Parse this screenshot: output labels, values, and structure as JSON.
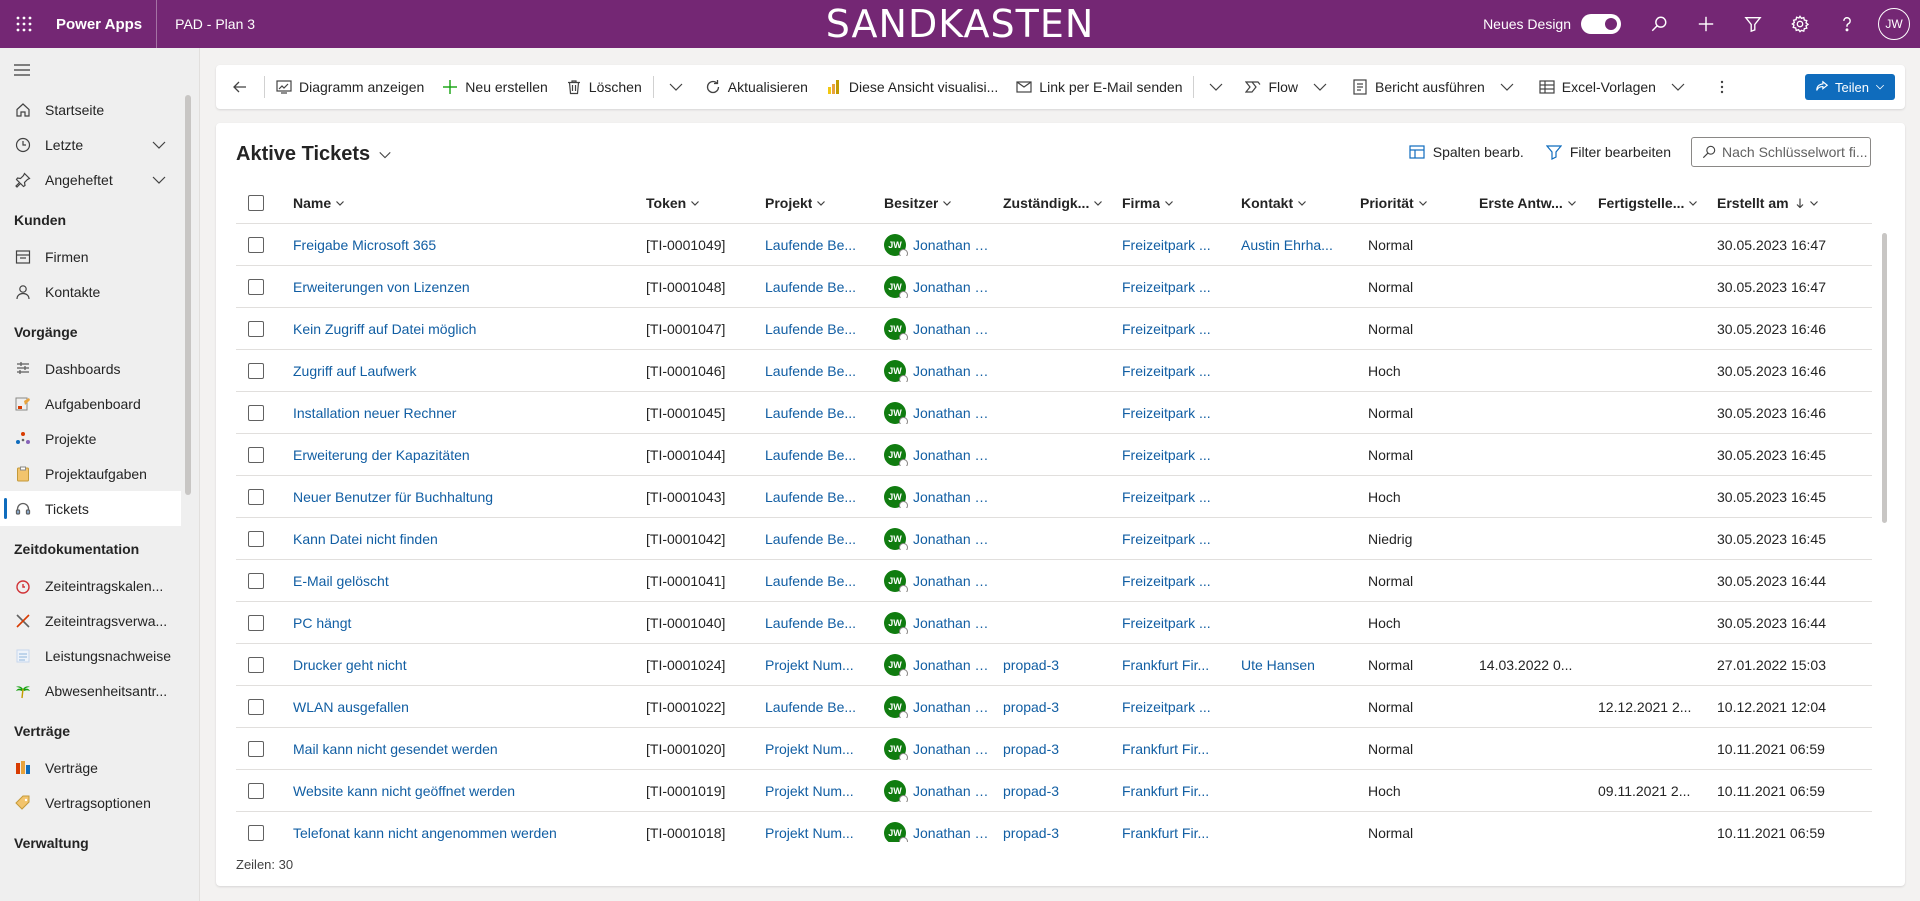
{
  "header": {
    "app_name": "Power Apps",
    "env_name": "PAD - Plan 3",
    "banner": "SANDKASTEN",
    "new_design_label": "Neues Design",
    "user_initials": "JW"
  },
  "sidebar": {
    "items_top": [
      {
        "label": "Startseite",
        "icon": "home-icon"
      },
      {
        "label": "Letzte",
        "icon": "clock-icon"
      },
      {
        "label": "Angeheftet",
        "icon": "pin-icon"
      }
    ],
    "groups": [
      {
        "title": "Kunden",
        "items": [
          {
            "label": "Firmen",
            "icon": "building-icon"
          },
          {
            "label": "Kontakte",
            "icon": "person-icon"
          }
        ]
      },
      {
        "title": "Vorgänge",
        "items": [
          {
            "label": "Dashboards",
            "icon": "dashboard-icon"
          },
          {
            "label": "Aufgabenboard",
            "icon": "board-icon"
          },
          {
            "label": "Projekte",
            "icon": "projects-icon"
          },
          {
            "label": "Projektaufgaben",
            "icon": "clipboard-icon"
          },
          {
            "label": "Tickets",
            "icon": "headset-icon"
          }
        ]
      },
      {
        "title": "Zeitdokumentation",
        "items": [
          {
            "label": "Zeiteintragskalen...",
            "icon": "stopwatch-icon"
          },
          {
            "label": "Zeiteintragsverwa...",
            "icon": "tools-icon"
          },
          {
            "label": "Leistungsnachweise",
            "icon": "list-icon"
          },
          {
            "label": "Abwesenheitsantr...",
            "icon": "palm-icon"
          }
        ]
      },
      {
        "title": "Verträge",
        "items": [
          {
            "label": "Verträge",
            "icon": "contract-icon"
          },
          {
            "label": "Vertragsoptionen",
            "icon": "tag-icon"
          }
        ]
      },
      {
        "title": "Verwaltung",
        "items": []
      }
    ]
  },
  "toolbar": {
    "chart": "Diagramm anzeigen",
    "new": "Neu erstellen",
    "delete": "Löschen",
    "refresh": "Aktualisieren",
    "visualize": "Diese Ansicht visualisi...",
    "email_link": "Link per E-Mail senden",
    "flow": "Flow",
    "report": "Bericht ausführen",
    "excel": "Excel-Vorlagen",
    "share": "Teilen"
  },
  "view": {
    "title": "Aktive Tickets",
    "edit_columns": "Spalten bearb.",
    "edit_filters": "Filter bearbeiten",
    "search_placeholder": "Nach Schlüsselwort fi...",
    "row_count": "Zeilen: 30"
  },
  "columns": {
    "name": "Name",
    "token": "Token",
    "projekt": "Projekt",
    "besitzer": "Besitzer",
    "zustaendig": "Zuständigk...",
    "firma": "Firma",
    "kontakt": "Kontakt",
    "prioritaet": "Priorität",
    "erste_antwort": "Erste Antw...",
    "fertigstellen": "Fertigstelle...",
    "erstellt_am": "Erstellt am"
  },
  "rows": [
    {
      "name": "Freigabe Microsoft 365",
      "token": "[TI-0001049]",
      "projekt": "Laufende Be...",
      "owner_initials": "JW",
      "owner": "Jonathan W...",
      "zust": "",
      "firma": "Freizeitpark ...",
      "kontakt": "Austin Ehrha...",
      "prio": "Normal",
      "erste": "",
      "fertig": "",
      "erstellt": "30.05.2023 16:47"
    },
    {
      "name": "Erweiterungen von Lizenzen",
      "token": "[TI-0001048]",
      "projekt": "Laufende Be...",
      "owner_initials": "JW",
      "owner": "Jonathan W...",
      "zust": "",
      "firma": "Freizeitpark ...",
      "kontakt": "",
      "prio": "Normal",
      "erste": "",
      "fertig": "",
      "erstellt": "30.05.2023 16:47"
    },
    {
      "name": "Kein Zugriff auf Datei möglich",
      "token": "[TI-0001047]",
      "projekt": "Laufende Be...",
      "owner_initials": "JW",
      "owner": "Jonathan W...",
      "zust": "",
      "firma": "Freizeitpark ...",
      "kontakt": "",
      "prio": "Normal",
      "erste": "",
      "fertig": "",
      "erstellt": "30.05.2023 16:46"
    },
    {
      "name": "Zugriff auf Laufwerk",
      "token": "[TI-0001046]",
      "projekt": "Laufende Be...",
      "owner_initials": "JW",
      "owner": "Jonathan W...",
      "zust": "",
      "firma": "Freizeitpark ...",
      "kontakt": "",
      "prio": "Hoch",
      "erste": "",
      "fertig": "",
      "erstellt": "30.05.2023 16:46"
    },
    {
      "name": "Installation neuer Rechner",
      "token": "[TI-0001045]",
      "projekt": "Laufende Be...",
      "owner_initials": "JW",
      "owner": "Jonathan W...",
      "zust": "",
      "firma": "Freizeitpark ...",
      "kontakt": "",
      "prio": "Normal",
      "erste": "",
      "fertig": "",
      "erstellt": "30.05.2023 16:46"
    },
    {
      "name": "Erweiterung der Kapazitäten",
      "token": "[TI-0001044]",
      "projekt": "Laufende Be...",
      "owner_initials": "JW",
      "owner": "Jonathan W...",
      "zust": "",
      "firma": "Freizeitpark ...",
      "kontakt": "",
      "prio": "Normal",
      "erste": "",
      "fertig": "",
      "erstellt": "30.05.2023 16:45"
    },
    {
      "name": "Neuer Benutzer für Buchhaltung",
      "token": "[TI-0001043]",
      "projekt": "Laufende Be...",
      "owner_initials": "JW",
      "owner": "Jonathan W...",
      "zust": "",
      "firma": "Freizeitpark ...",
      "kontakt": "",
      "prio": "Hoch",
      "erste": "",
      "fertig": "",
      "erstellt": "30.05.2023 16:45"
    },
    {
      "name": "Kann Datei nicht finden",
      "token": "[TI-0001042]",
      "projekt": "Laufende Be...",
      "owner_initials": "JW",
      "owner": "Jonathan W...",
      "zust": "",
      "firma": "Freizeitpark ...",
      "kontakt": "",
      "prio": "Niedrig",
      "erste": "",
      "fertig": "",
      "erstellt": "30.05.2023 16:45"
    },
    {
      "name": "E-Mail gelöscht",
      "token": "[TI-0001041]",
      "projekt": "Laufende Be...",
      "owner_initials": "JW",
      "owner": "Jonathan W...",
      "zust": "",
      "firma": "Freizeitpark ...",
      "kontakt": "",
      "prio": "Normal",
      "erste": "",
      "fertig": "",
      "erstellt": "30.05.2023 16:44"
    },
    {
      "name": "PC hängt",
      "token": "[TI-0001040]",
      "projekt": "Laufende Be...",
      "owner_initials": "JW",
      "owner": "Jonathan W...",
      "zust": "",
      "firma": "Freizeitpark ...",
      "kontakt": "",
      "prio": "Hoch",
      "erste": "",
      "fertig": "",
      "erstellt": "30.05.2023 16:44"
    },
    {
      "name": "Drucker geht nicht",
      "token": "[TI-0001024]",
      "projekt": "Projekt Num...",
      "owner_initials": "JW",
      "owner": "Jonathan W...",
      "zust": "propad-3",
      "firma": "Frankfurt Fir...",
      "kontakt": "Ute Hansen",
      "prio": "Normal",
      "erste": "14.03.2022 0...",
      "fertig": "",
      "erstellt": "27.01.2022 15:03"
    },
    {
      "name": "WLAN ausgefallen",
      "token": "[TI-0001022]",
      "projekt": "Laufende Be...",
      "owner_initials": "JW",
      "owner": "Jonathan W...",
      "zust": "propad-3",
      "firma": "Freizeitpark ...",
      "kontakt": "",
      "prio": "Normal",
      "erste": "",
      "fertig": "12.12.2021 2...",
      "erstellt": "10.12.2021 12:04"
    },
    {
      "name": "Mail kann nicht gesendet werden",
      "token": "[TI-0001020]",
      "projekt": "Projekt Num...",
      "owner_initials": "JW",
      "owner": "Jonathan W...",
      "zust": "propad-3",
      "firma": "Frankfurt Fir...",
      "kontakt": "",
      "prio": "Normal",
      "erste": "",
      "fertig": "",
      "erstellt": "10.11.2021 06:59"
    },
    {
      "name": "Website kann nicht geöffnet werden",
      "token": "[TI-0001019]",
      "projekt": "Projekt Num...",
      "owner_initials": "JW",
      "owner": "Jonathan W...",
      "zust": "propad-3",
      "firma": "Frankfurt Fir...",
      "kontakt": "",
      "prio": "Hoch",
      "erste": "",
      "fertig": "09.11.2021 2...",
      "erstellt": "10.11.2021 06:59"
    },
    {
      "name": "Telefonat kann nicht angenommen werden",
      "token": "[TI-0001018]",
      "projekt": "Projekt Num...",
      "owner_initials": "JW",
      "owner": "Jonathan W...",
      "zust": "propad-3",
      "firma": "Frankfurt Fir...",
      "kontakt": "",
      "prio": "Normal",
      "erste": "",
      "fertig": "",
      "erstellt": "10.11.2021 06:59"
    }
  ],
  "colors": {
    "header": "#742774",
    "accent": "#0f6cbd",
    "link": "#115ea3",
    "avatar": "#107c10"
  }
}
